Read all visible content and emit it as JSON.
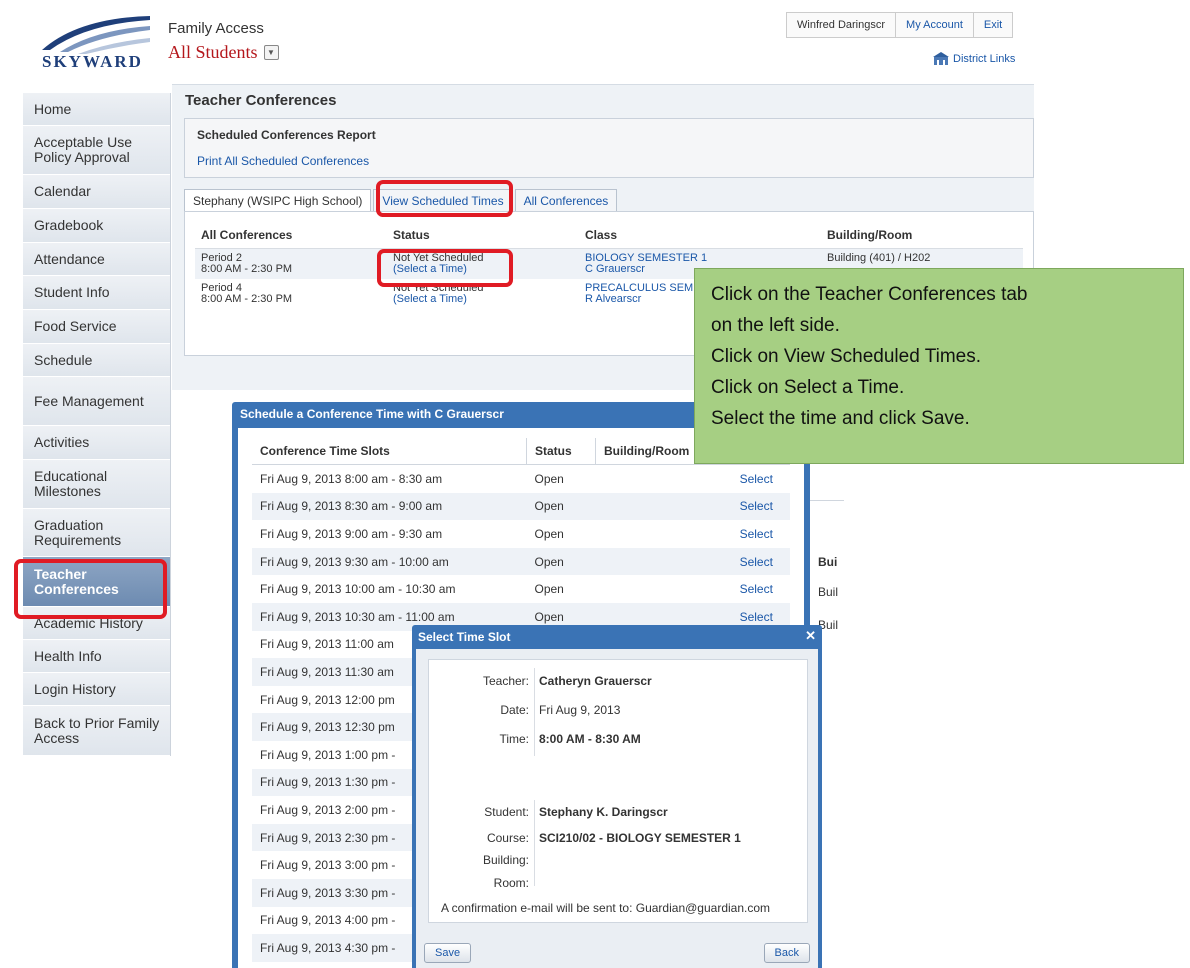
{
  "header": {
    "app_title": "Family Access",
    "student_selector": "All Students",
    "user_name": "Winfred Daringscr",
    "my_account": "My Account",
    "exit": "Exit",
    "district_links": "District Links",
    "logo_text": "SKYWARD"
  },
  "sidebar": {
    "items": [
      {
        "label": "Home"
      },
      {
        "label": "Acceptable Use Policy Approval"
      },
      {
        "label": "Calendar"
      },
      {
        "label": "Gradebook"
      },
      {
        "label": "Attendance"
      },
      {
        "label": "Student Info"
      },
      {
        "label": "Food Service"
      },
      {
        "label": "Schedule"
      },
      {
        "label": "Fee Management"
      },
      {
        "label": "Activities"
      },
      {
        "label": "Educational Milestones"
      },
      {
        "label": "Graduation Requirements"
      },
      {
        "label": "Teacher Conferences"
      },
      {
        "label": "Academic History"
      },
      {
        "label": "Health Info"
      },
      {
        "label": "Login History"
      },
      {
        "label": "Back to Prior Family Access"
      }
    ]
  },
  "main": {
    "page_title": "Teacher Conferences",
    "report_title": "Scheduled Conferences Report",
    "report_link": "Print All Scheduled Conferences",
    "tabs": [
      "Stephany (WSIPC High School)",
      "View Scheduled Times",
      "All Conferences"
    ],
    "table": {
      "headers": [
        "All Conferences",
        "Status",
        "Class",
        "Building/Room"
      ],
      "rows": [
        {
          "period": "Period 2",
          "time": "8:00 AM - 2:30 PM",
          "status": "Not Yet Scheduled",
          "action": "(Select a Time)",
          "class": "BIOLOGY SEMESTER 1",
          "teacher": "C Grauerscr",
          "room": "Building (401) / H202"
        },
        {
          "period": "Period 4",
          "time": "8:00 AM - 2:30 PM",
          "status": "Not Yet Scheduled",
          "action": "(Select a Time)",
          "class": "PRECALCULUS SEM",
          "teacher": "R Alvearscr",
          "room": ""
        }
      ]
    }
  },
  "callout": {
    "lines": [
      "Click on the Teacher Conferences tab",
      "on the left side.",
      "Click on View Scheduled Times.",
      "Click on Select a Time.",
      "Select the time and click Save."
    ]
  },
  "schedule_dialog": {
    "title": "Schedule a Conference Time with C Grauerscr",
    "headers": [
      "Conference Time Slots",
      "Status",
      "Building/Room"
    ],
    "select_label": "Select",
    "slots": [
      {
        "time": "Fri Aug 9, 2013 8:00 am - 8:30 am",
        "status": "Open",
        "select": "Select"
      },
      {
        "time": "Fri Aug 9, 2013 8:30 am - 9:00 am",
        "status": "Open",
        "select": "Select"
      },
      {
        "time": "Fri Aug 9, 2013 9:00 am - 9:30 am",
        "status": "Open",
        "select": "Select"
      },
      {
        "time": "Fri Aug 9, 2013 9:30 am - 10:00 am",
        "status": "Open",
        "select": "Select"
      },
      {
        "time": "Fri Aug 9, 2013 10:00 am - 10:30 am",
        "status": "Open",
        "select": "Select"
      },
      {
        "time": "Fri Aug 9, 2013 10:30 am - 11:00 am",
        "status": "Open",
        "select": "Select"
      },
      {
        "time": "Fri Aug 9, 2013 11:00 am",
        "status": "",
        "select": ""
      },
      {
        "time": "Fri Aug 9, 2013 11:30 am",
        "status": "",
        "select": ""
      },
      {
        "time": "Fri Aug 9, 2013 12:00 pm",
        "status": "",
        "select": ""
      },
      {
        "time": "Fri Aug 9, 2013 12:30 pm",
        "status": "",
        "select": ""
      },
      {
        "time": "Fri Aug 9, 2013 1:00 pm -",
        "status": "",
        "select": ""
      },
      {
        "time": "Fri Aug 9, 2013 1:30 pm -",
        "status": "",
        "select": ""
      },
      {
        "time": "Fri Aug 9, 2013 2:00 pm -",
        "status": "",
        "select": ""
      },
      {
        "time": "Fri Aug 9, 2013 2:30 pm -",
        "status": "",
        "select": ""
      },
      {
        "time": "Fri Aug 9, 2013 3:00 pm -",
        "status": "",
        "select": ""
      },
      {
        "time": "Fri Aug 9, 2013 3:30 pm -",
        "status": "",
        "select": ""
      },
      {
        "time": "Fri Aug 9, 2013 4:00 pm -",
        "status": "",
        "select": ""
      },
      {
        "time": "Fri Aug 9, 2013 4:30 pm -",
        "status": "",
        "select": ""
      }
    ]
  },
  "background_fragments": {
    "a": "Bui",
    "b": "Buil",
    "c": "Buil"
  },
  "slot_dialog": {
    "title": "Select Time Slot",
    "close": "✕",
    "fields": {
      "teacher_label": "Teacher:",
      "teacher": "Catheryn Grauerscr",
      "date_label": "Date:",
      "date": "Fri Aug 9, 2013",
      "time_label": "Time:",
      "time": "8:00 AM - 8:30 AM",
      "student_label": "Student:",
      "student": "Stephany K. Daringscr",
      "course_label": "Course:",
      "course": "SCI210/02 - BIOLOGY SEMESTER 1",
      "building_label": "Building:",
      "room_label": "Room:"
    },
    "confirmation": "A confirmation e-mail will be sent to: Guardian@guardian.com",
    "save": "Save",
    "back": "Back"
  }
}
